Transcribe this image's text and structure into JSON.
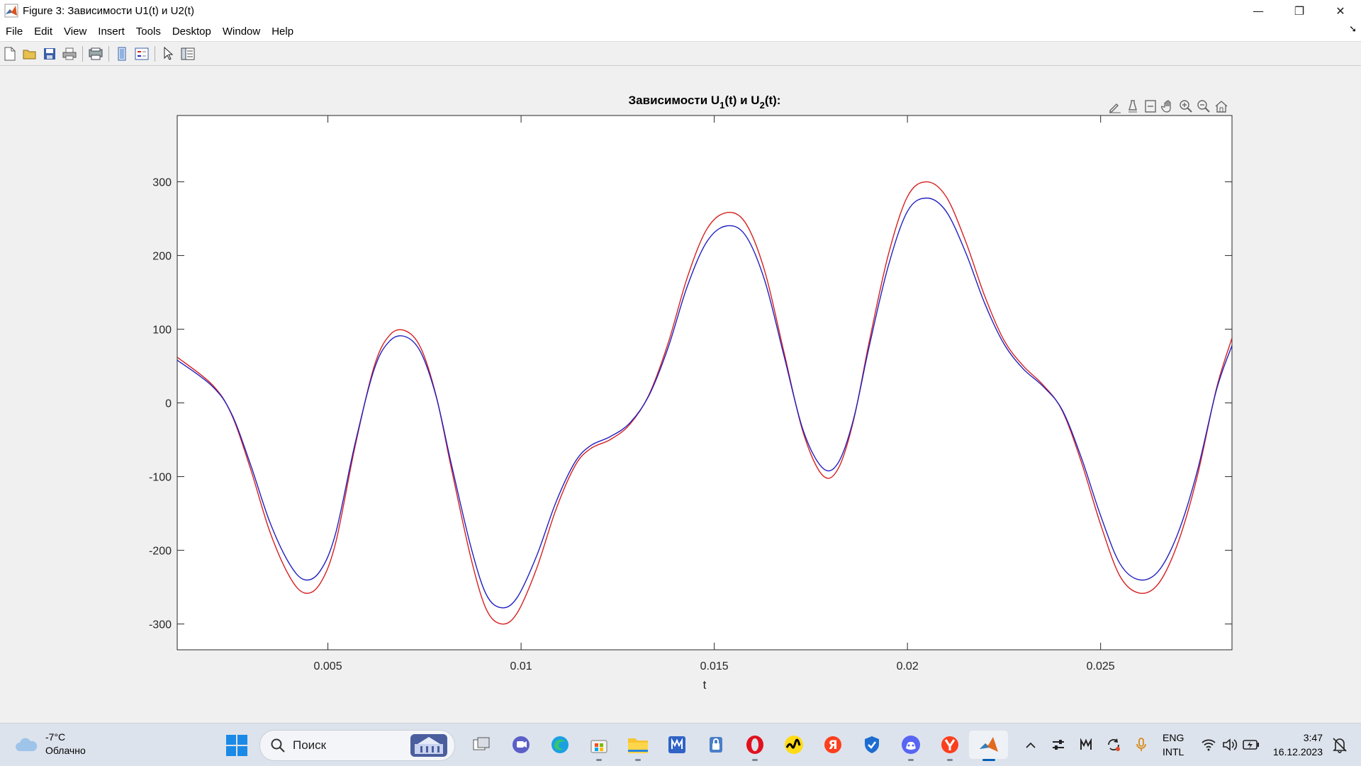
{
  "window": {
    "title": "Figure 3: Зависимости U1(t) и U2(t)",
    "controls": [
      "—",
      "❐",
      "✕"
    ]
  },
  "menu": [
    "File",
    "Edit",
    "View",
    "Insert",
    "Tools",
    "Desktop",
    "Window",
    "Help"
  ],
  "toolbar_icons": [
    "new-figure-icon",
    "open-icon",
    "save-icon",
    "print-icon",
    "print-preview-icon",
    "colorbar-icon",
    "legend-icon",
    "pointer-icon",
    "property-inspector-icon"
  ],
  "axes_toolbar_icons": [
    "brush-icon",
    "data-tips-icon",
    "restore-view-icon",
    "pan-icon",
    "zoom-in-icon",
    "zoom-out-icon",
    "home-icon"
  ],
  "chart_data": {
    "type": "line",
    "title": "Зависимости U1(t) и U2(t):",
    "title_parts": {
      "a": "Зависимости U",
      "sub1": "1",
      "b": "(t) и U",
      "sub2": "2",
      "c": "(t):"
    },
    "xlabel": "t",
    "ylabel": "",
    "xlim": [
      0.0011,
      0.0284
    ],
    "ylim": [
      -335,
      390
    ],
    "xticks": [
      0.005,
      0.01,
      0.015,
      0.02,
      0.025
    ],
    "xtick_labels": [
      "0.005",
      "0.01",
      "0.015",
      "0.02",
      "0.025"
    ],
    "yticks": [
      -300,
      -200,
      -100,
      0,
      100,
      200,
      300
    ],
    "ytick_labels": [
      "-300",
      "-200",
      "-100",
      "0",
      "100",
      "200",
      "300"
    ],
    "grid": false,
    "legend": "none",
    "series": [
      {
        "color": "#d62020",
        "points": [
          [
            0.0011,
            62
          ],
          [
            0.002,
            25
          ],
          [
            0.0025,
            -15
          ],
          [
            0.003,
            -90
          ],
          [
            0.0035,
            -175
          ],
          [
            0.004,
            -235
          ],
          [
            0.0044,
            -258
          ],
          [
            0.0048,
            -245
          ],
          [
            0.0052,
            -190
          ],
          [
            0.0057,
            -60
          ],
          [
            0.0062,
            50
          ],
          [
            0.0066,
            92
          ],
          [
            0.007,
            98
          ],
          [
            0.0074,
            75
          ],
          [
            0.0078,
            10
          ],
          [
            0.0082,
            -90
          ],
          [
            0.0087,
            -210
          ],
          [
            0.0091,
            -280
          ],
          [
            0.0095,
            -300
          ],
          [
            0.0099,
            -285
          ],
          [
            0.0104,
            -225
          ],
          [
            0.0109,
            -145
          ],
          [
            0.0114,
            -85
          ],
          [
            0.0118,
            -62
          ],
          [
            0.0123,
            -50
          ],
          [
            0.0128,
            -30
          ],
          [
            0.0133,
            10
          ],
          [
            0.0138,
            80
          ],
          [
            0.0143,
            170
          ],
          [
            0.0148,
            235
          ],
          [
            0.0153,
            258
          ],
          [
            0.0158,
            245
          ],
          [
            0.0163,
            180
          ],
          [
            0.0168,
            70
          ],
          [
            0.0173,
            -40
          ],
          [
            0.0178,
            -98
          ],
          [
            0.0182,
            -90
          ],
          [
            0.0186,
            -25
          ],
          [
            0.019,
            80
          ],
          [
            0.0195,
            200
          ],
          [
            0.02,
            280
          ],
          [
            0.0205,
            300
          ],
          [
            0.021,
            280
          ],
          [
            0.0215,
            220
          ],
          [
            0.022,
            145
          ],
          [
            0.0225,
            85
          ],
          [
            0.023,
            50
          ],
          [
            0.0235,
            25
          ],
          [
            0.024,
            -10
          ],
          [
            0.0245,
            -80
          ],
          [
            0.025,
            -165
          ],
          [
            0.0255,
            -235
          ],
          [
            0.026,
            -258
          ],
          [
            0.0265,
            -245
          ],
          [
            0.027,
            -190
          ],
          [
            0.0275,
            -100
          ],
          [
            0.028,
            20
          ],
          [
            0.0284,
            88
          ]
        ]
      },
      {
        "color": "#2020c0",
        "points": [
          [
            0.0011,
            58
          ],
          [
            0.002,
            23
          ],
          [
            0.0025,
            -14
          ],
          [
            0.003,
            -84
          ],
          [
            0.0035,
            -162
          ],
          [
            0.004,
            -218
          ],
          [
            0.0044,
            -240
          ],
          [
            0.0048,
            -228
          ],
          [
            0.0052,
            -177
          ],
          [
            0.0057,
            -56
          ],
          [
            0.0062,
            46
          ],
          [
            0.0066,
            84
          ],
          [
            0.007,
            90
          ],
          [
            0.0074,
            69
          ],
          [
            0.0078,
            9
          ],
          [
            0.0082,
            -84
          ],
          [
            0.0087,
            -195
          ],
          [
            0.0091,
            -260
          ],
          [
            0.0095,
            -278
          ],
          [
            0.0099,
            -264
          ],
          [
            0.0104,
            -208
          ],
          [
            0.0109,
            -135
          ],
          [
            0.0114,
            -80
          ],
          [
            0.0118,
            -58
          ],
          [
            0.0123,
            -46
          ],
          [
            0.0128,
            -28
          ],
          [
            0.0133,
            9
          ],
          [
            0.0138,
            74
          ],
          [
            0.0143,
            158
          ],
          [
            0.0148,
            218
          ],
          [
            0.0153,
            240
          ],
          [
            0.0158,
            228
          ],
          [
            0.0163,
            167
          ],
          [
            0.0168,
            65
          ],
          [
            0.0173,
            -37
          ],
          [
            0.0178,
            -88
          ],
          [
            0.0182,
            -82
          ],
          [
            0.0186,
            -23
          ],
          [
            0.019,
            74
          ],
          [
            0.0195,
            185
          ],
          [
            0.02,
            260
          ],
          [
            0.0205,
            278
          ],
          [
            0.021,
            260
          ],
          [
            0.0215,
            205
          ],
          [
            0.022,
            135
          ],
          [
            0.0225,
            80
          ],
          [
            0.023,
            46
          ],
          [
            0.0235,
            23
          ],
          [
            0.024,
            -9
          ],
          [
            0.0245,
            -74
          ],
          [
            0.025,
            -153
          ],
          [
            0.0255,
            -218
          ],
          [
            0.026,
            -240
          ],
          [
            0.0265,
            -228
          ],
          [
            0.027,
            -177
          ],
          [
            0.0275,
            -93
          ],
          [
            0.028,
            18
          ],
          [
            0.0284,
            78
          ]
        ]
      }
    ]
  },
  "taskbar": {
    "weather_temp": "-7°C",
    "weather_desc": "Облачно",
    "search_label": "Поиск",
    "apps": [
      "task-view-icon",
      "teams-chat-icon",
      "edge-icon",
      "store-icon",
      "file-explorer-icon",
      "imaging-app-icon",
      "vpn-lock-icon",
      "opera-icon",
      "yandex-music-icon",
      "yandex-icon",
      "shield-app-icon",
      "discord-icon",
      "yandex-browser-icon",
      "matlab-icon"
    ],
    "tray": [
      "chevron-up-icon",
      "tray-settings-icon",
      "tray-app-icon",
      "sync-icon",
      "microphone-icon"
    ],
    "lang_primary": "ENG",
    "lang_secondary": "INTL",
    "time": "3:47",
    "date": "16.12.2023"
  }
}
